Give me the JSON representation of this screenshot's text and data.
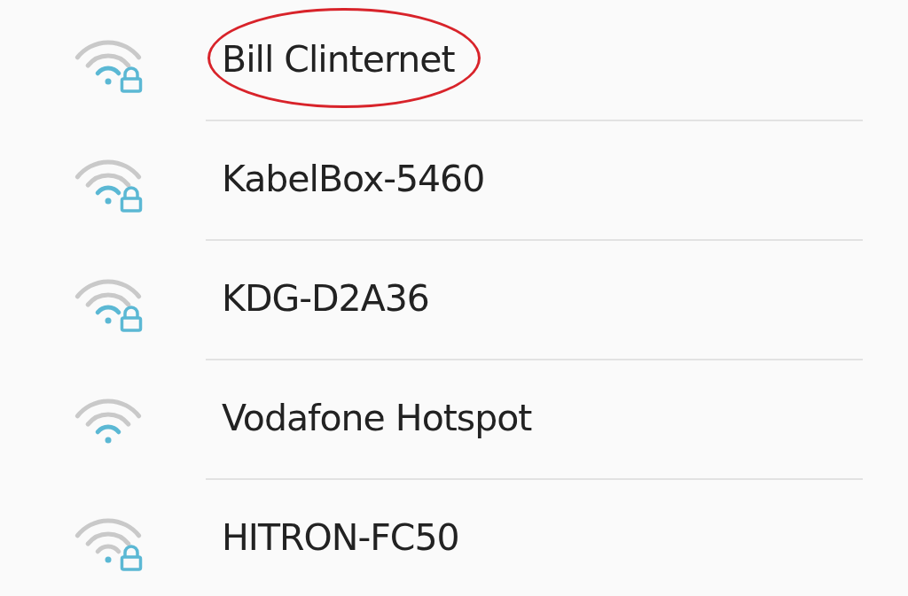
{
  "networks": [
    {
      "name": "Bill Clinternet",
      "weak_signal": false,
      "locked": true,
      "circled": true
    },
    {
      "name": "KabelBox-5460",
      "weak_signal": false,
      "locked": true,
      "circled": false
    },
    {
      "name": "KDG-D2A36",
      "weak_signal": false,
      "locked": true,
      "circled": false
    },
    {
      "name": "Vodafone Hotspot",
      "weak_signal": false,
      "locked": false,
      "circled": false
    },
    {
      "name": "HITRON-FC50",
      "weak_signal": true,
      "locked": true,
      "circled": false
    }
  ]
}
